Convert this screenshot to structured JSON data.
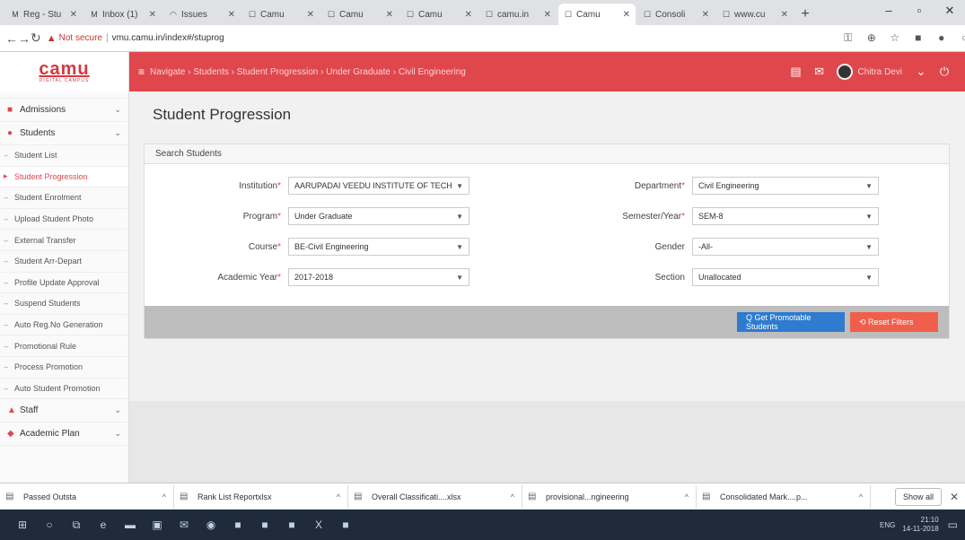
{
  "browser": {
    "tabs": [
      {
        "icon": "M",
        "title": "Reg - Stu",
        "active": false
      },
      {
        "icon": "M",
        "title": "Inbox (1)",
        "active": false
      },
      {
        "icon": "◠",
        "title": "Issues",
        "active": false
      },
      {
        "icon": "☐",
        "title": "Camu",
        "active": false
      },
      {
        "icon": "☐",
        "title": "Camu",
        "active": false
      },
      {
        "icon": "☐",
        "title": "Camu",
        "active": false
      },
      {
        "icon": "☐",
        "title": "camu.in",
        "active": false
      },
      {
        "icon": "☐",
        "title": "Camu",
        "active": true
      },
      {
        "icon": "☐",
        "title": "Consoli",
        "active": false
      },
      {
        "icon": "☐",
        "title": "www.cu",
        "active": false
      }
    ],
    "new_tab": "+",
    "address": {
      "warning": "Not secure",
      "url": "vmu.camu.in/index#/stuprog"
    },
    "window_controls": [
      "–",
      "▫",
      "✕"
    ],
    "ext_icons": [
      "key-icon",
      "zoom-icon",
      "star-icon",
      "extension-icon",
      "profile-icon",
      "menu-icon"
    ]
  },
  "app": {
    "logo": "camu",
    "logo_sub": "DIGITAL CAMPUS",
    "breadcrumb": "Navigate › Students › Student Progression › Under Graduate › Civil Engineering",
    "user_name": "Chitra Devi"
  },
  "sidebar": {
    "sections": [
      {
        "label": "Admissions",
        "icon": "admissions-icon",
        "caret": "⌄"
      },
      {
        "label": "Students",
        "icon": "students-icon",
        "caret": "⌄"
      }
    ],
    "student_items": [
      {
        "label": "Student List",
        "active": false
      },
      {
        "label": "Student Progression",
        "active": true
      },
      {
        "label": "Student Enrolment",
        "active": false
      },
      {
        "label": "Upload Student Photo",
        "active": false
      },
      {
        "label": "External Transfer",
        "active": false
      },
      {
        "label": "Student Arr-Depart",
        "active": false
      },
      {
        "label": "Profile Update Approval",
        "active": false
      },
      {
        "label": "Suspend Students",
        "active": false
      },
      {
        "label": "Auto Reg.No Generation",
        "active": false
      },
      {
        "label": "Promotional Rule",
        "active": false
      },
      {
        "label": "Process Promotion",
        "active": false
      },
      {
        "label": "Auto Student Promotion",
        "active": false
      }
    ],
    "bottom_sections": [
      {
        "label": "Staff",
        "icon": "staff-icon",
        "caret": "⌄"
      },
      {
        "label": "Academic Plan",
        "icon": "academic-plan-icon",
        "caret": "⌄"
      }
    ]
  },
  "main": {
    "title": "Student Progression",
    "panel_title": "Search Students",
    "fields": {
      "institution": {
        "label": "Institution",
        "value": "AARUPADAI VEEDU INSTITUTE OF TECH"
      },
      "program": {
        "label": "Program",
        "value": "Under Graduate"
      },
      "course": {
        "label": "Course",
        "value": "BE-Civil Engineering"
      },
      "academic_year": {
        "label": "Academic Year",
        "value": "2017-2018"
      },
      "department": {
        "label": "Department",
        "value": "Civil Engineering"
      },
      "semester_year": {
        "label": "Semester/Year",
        "value": "SEM-8"
      },
      "gender": {
        "label": "Gender",
        "value": "-All-"
      },
      "section": {
        "label": "Section",
        "value": "Unallocated"
      }
    },
    "required_mark": "*",
    "buttons": {
      "search": "Q Get Promotable Students",
      "reset": "⟲ Reset Filters"
    }
  },
  "downloads": {
    "items": [
      {
        "name": "Passed Outsta"
      },
      {
        "name": "Rank List Reportxlsx"
      },
      {
        "name": "Overall Classificati....xlsx"
      },
      {
        "name": "provisional...ngineering"
      },
      {
        "name": "Consolidated Mark....p..."
      }
    ],
    "caret": "^",
    "show_all": "Show all",
    "close": "✕"
  },
  "taskbar": {
    "icons": [
      "windows-icon",
      "search-icon",
      "task-view-icon",
      "edge-icon",
      "file-explorer-icon",
      "store-icon",
      "mail-icon",
      "firefox-icon",
      "app-icon",
      "app-icon",
      "app-icon",
      "excel-icon",
      "app-icon"
    ],
    "tray_text": "ENG",
    "time": "21:10",
    "date": "14-11-2018"
  }
}
